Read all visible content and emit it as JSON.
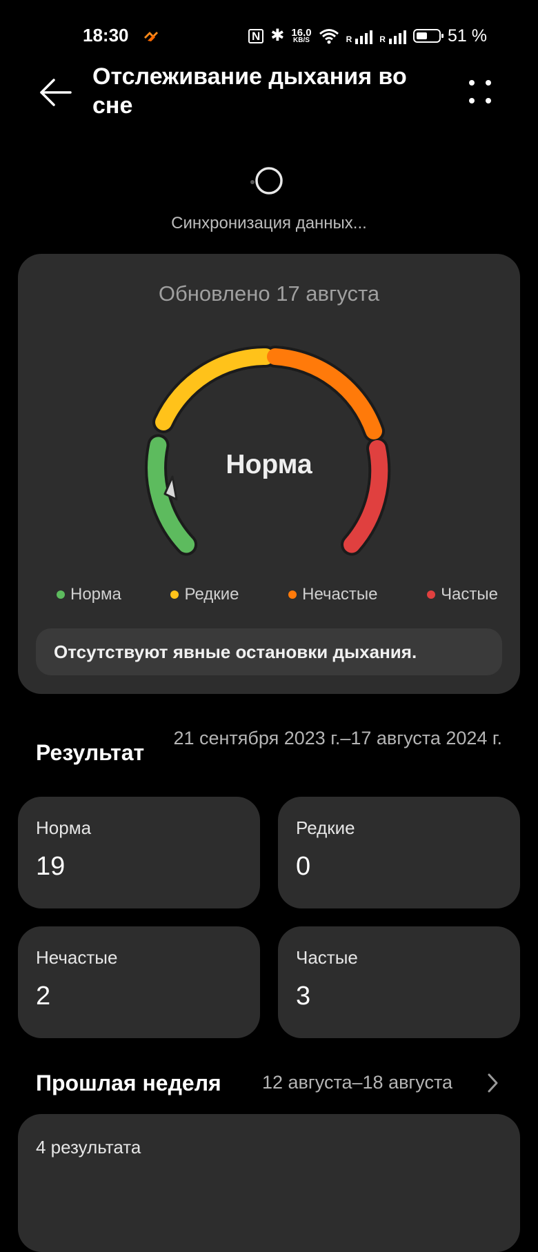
{
  "status_bar": {
    "time": "18:30",
    "nfc": "N",
    "bluetooth": "✱",
    "speed_value": "16.0",
    "speed_unit": "KB/S",
    "roaming": "R",
    "battery_level": 51,
    "battery_text": "51 %"
  },
  "header": {
    "title": "Отслеживание дыхания во сне",
    "back_icon": "arrow-left-icon",
    "more_icon": "more-dots-icon"
  },
  "sync": {
    "text": "Синхронизация данных..."
  },
  "gauge_card": {
    "updated": "Обновлено 17 августа",
    "status": "Норма",
    "segments": [
      {
        "name": "Норма",
        "color": "#5dbb5e"
      },
      {
        "name": "Редкие",
        "color": "#ffc21a"
      },
      {
        "name": "Нечастые",
        "color": "#ff7a0a"
      },
      {
        "name": "Частые",
        "color": "#e0403f"
      }
    ],
    "note": "Отсутствуют явные остановки дыхания."
  },
  "result": {
    "title": "Результат",
    "range": "21 сентября 2023 г.–17 августа 2024 г.",
    "stats": [
      {
        "label": "Норма",
        "value": "19"
      },
      {
        "label": "Редкие",
        "value": "0"
      },
      {
        "label": "Нечастые",
        "value": "2"
      },
      {
        "label": "Частые",
        "value": "3"
      }
    ]
  },
  "last_week": {
    "title": "Прошлая неделя",
    "range": "12 августа–18 августа",
    "count": "4 результата"
  }
}
